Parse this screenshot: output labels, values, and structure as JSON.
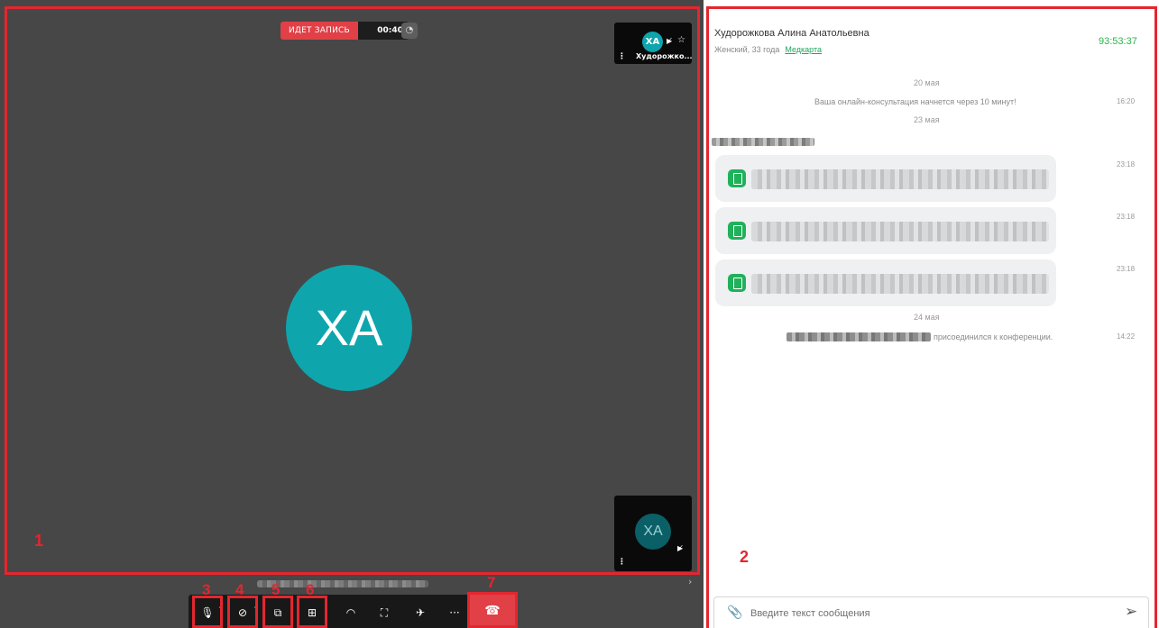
{
  "recording": {
    "label": "ИДЕТ ЗАПИСЬ",
    "time": "00:40",
    "info_icon": "gauge-icon"
  },
  "main_avatar": {
    "initials": "XA",
    "color": "#0fa5ad"
  },
  "thumbnails": {
    "top": {
      "initials": "XA",
      "name": "Худорожко...",
      "mute_icon": "camera-off-icon",
      "pin_icon": "star-icon"
    },
    "bottom": {
      "initials": "XA",
      "mute_icon": "camera-off-icon"
    }
  },
  "markers": {
    "video": "1",
    "chat": "2",
    "mic": "3",
    "camera": "4",
    "share": "5",
    "layout": "6",
    "hangup": "7"
  },
  "toolbar": {
    "icons": [
      "microphone-icon",
      "camera-off-icon",
      "screen-share-icon",
      "grid-layout-icon",
      "speed-icon",
      "fullscreen-icon",
      "antenna-icon",
      "more-icon",
      "phone-hangup-icon"
    ],
    "hangup_color": "#e14047"
  },
  "chat": {
    "patient_name": "Худорожкова Алина Анатольевна",
    "patient_info": "Женский, 33 года",
    "medcard_link": "Медкарта",
    "timer": "93:53:37",
    "timer_color": "#2bb24c",
    "messages": {
      "date1": "20 мая",
      "sys1": "Ваша онлайн-консультация начнется через 10 минут!",
      "sys1_time": "16:20",
      "date2": "23 мая",
      "file1_time": "23:18",
      "file2_time": "23:18",
      "file3_time": "23:18",
      "date3": "24 мая",
      "join_text": "присоединился к конференции.",
      "join_time": "14:22"
    },
    "input_placeholder": "Введите текст сообщения"
  }
}
